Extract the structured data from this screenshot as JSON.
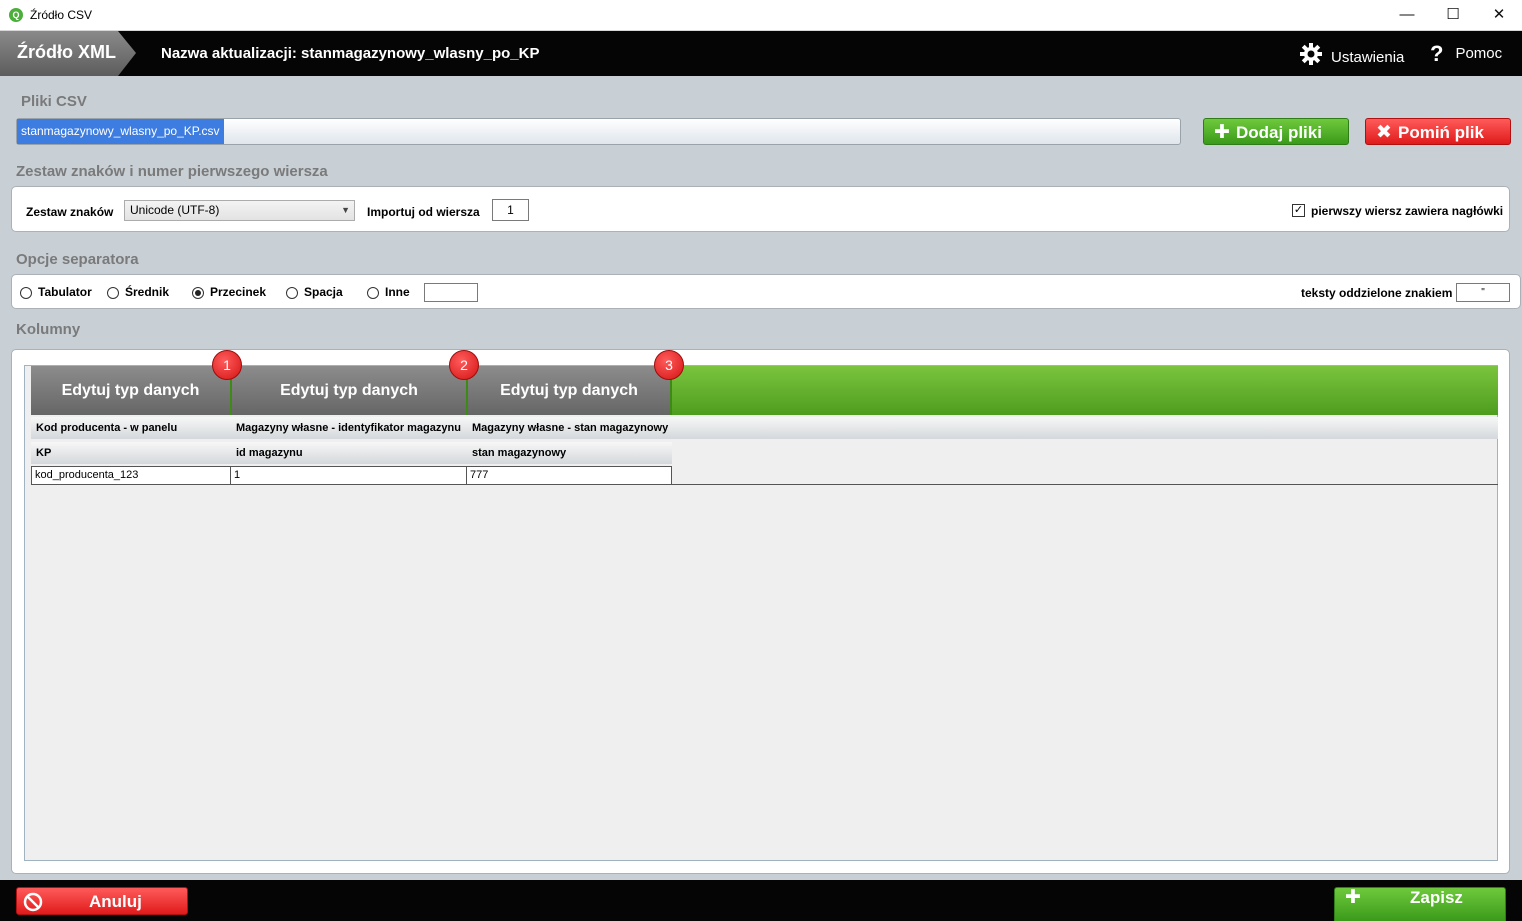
{
  "window": {
    "title": "Źródło CSV",
    "minimize": "—",
    "maximize": "☐",
    "close": "✕"
  },
  "header": {
    "source_tab": "Źródło XML",
    "update_title": "Nazwa aktualizacji: stanmagazynowy_wlasny_po_KP",
    "settings_label": "Ustawienia",
    "help_label": "Pomoc"
  },
  "csv_files": {
    "heading": "Pliki CSV",
    "file_name": "stanmagazynowy_wlasny_po_KP.csv",
    "add_label": "Dodaj pliki",
    "skip_label": "Pomiń plik"
  },
  "charset": {
    "heading": "Zestaw znaków i numer pierwszego wiersza",
    "charset_label": "Zestaw znaków",
    "charset_value": "Unicode (UTF-8)",
    "import_from_label": "Importuj od wiersza",
    "import_from_value": "1",
    "header_row_label": "pierwszy wiersz zawiera nagłówki",
    "header_row_checked": true
  },
  "separator": {
    "heading": "Opcje separatora",
    "options": [
      "Tabulator",
      "Średnik",
      "Przecinek",
      "Spacja",
      "Inne"
    ],
    "selected": "Przecinek",
    "other_value": "",
    "quote_label": "teksty oddzielone znakiem",
    "quote_value": "\""
  },
  "columns": {
    "heading": "Kolumny",
    "edit_buttons": [
      "Edytuj typ danych",
      "Edytuj typ danych",
      "Edytuj typ danych"
    ],
    "badges": [
      "1",
      "2",
      "3"
    ],
    "mapped_names": [
      "Kod producenta - w panelu",
      "Magazyny własne - identyfikator magazynu",
      "Magazyny własne - stan magazynowy"
    ],
    "csv_headers": [
      "KP",
      "id magazynu",
      "stan magazynowy"
    ],
    "rows": [
      [
        "kod_producenta_123",
        "1",
        "777"
      ]
    ]
  },
  "footer": {
    "cancel_label": "Anuluj",
    "save_label": "Zapisz"
  },
  "colors": {
    "green": "#4f9d1f",
    "red": "#e01b1b",
    "header_bg": "#050505",
    "selection": "#3d7ce0"
  }
}
